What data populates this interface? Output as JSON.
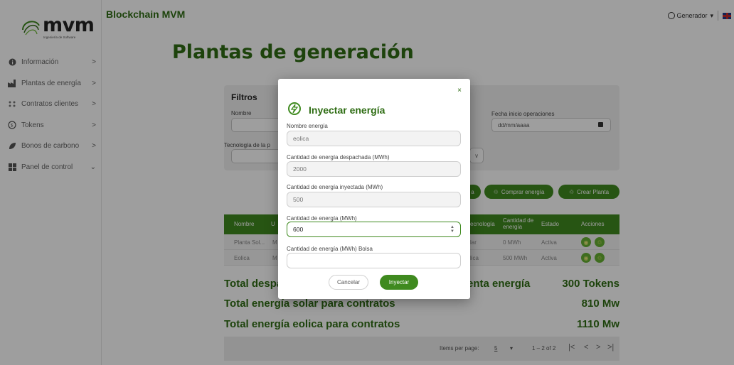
{
  "sidebar": {
    "logo_text": "mvm",
    "logo_sub": "Ingeniería de Software",
    "items": [
      {
        "label": "Información",
        "icon": "info-icon",
        "arrow": ">"
      },
      {
        "label": "Plantas de energía",
        "icon": "factory-icon",
        "arrow": ">"
      },
      {
        "label": "Contratos clientes",
        "icon": "contracts-icon",
        "arrow": ">"
      },
      {
        "label": "Tokens",
        "icon": "token-icon",
        "arrow": ">"
      },
      {
        "label": "Bonos de carbono",
        "icon": "leaf-icon",
        "arrow": ">"
      },
      {
        "label": "Panel de control",
        "icon": "dashboard-icon",
        "arrow": "⌄"
      }
    ]
  },
  "topbar": {
    "title": "Blockchain MVM",
    "user": "Generador",
    "user_caret": "▾"
  },
  "page": {
    "title": "Plantas de generación"
  },
  "filters": {
    "title": "Filtros",
    "nombre_label": "Nombre",
    "tecnologia_label": "Tecnología de la p",
    "fecha_label": "Fecha inicio operaciones",
    "fecha_placeholder": "dd/mm/aaaa"
  },
  "actions": {
    "first_partial": "a",
    "comprar": "Comprar energía",
    "crear": "Crear Planta"
  },
  "table": {
    "headers": {
      "nombre": "Nombre",
      "u": "U",
      "tecnologia": "ecnología",
      "cantidad": "Cantidad de energía",
      "estado": "Estado",
      "acciones": "Acciones"
    },
    "rows": [
      {
        "nombre": "Planta Sol...",
        "u": "M",
        "tecnologia": "lar",
        "cantidad": "0 MWh",
        "estado": "Activa"
      },
      {
        "nombre": "Eolica",
        "u": "M",
        "tecnologia": "lica",
        "cantidad": "500 MWh",
        "estado": "Activa"
      }
    ]
  },
  "summary": [
    {
      "label": "Total despa",
      "mid": "enta energía",
      "value": "300 Tokens"
    },
    {
      "label": "Total energía solar para contratos",
      "value": "810 Mw"
    },
    {
      "label": "Total energía eolica para contratos",
      "value": "1110 Mw"
    }
  ],
  "paginator": {
    "items_label": "Items per page:",
    "page_size": "5",
    "range": "1 – 2 of 2",
    "first": "|<",
    "prev": "<",
    "next": ">",
    "last": ">|"
  },
  "modal": {
    "title": "Inyectar energía",
    "close": "×",
    "fields": [
      {
        "label": "Nombre energía",
        "value": "eolica"
      },
      {
        "label": "Cantidad de energía despachada (MWh)",
        "value": "2000"
      },
      {
        "label": "Cantidad de energía inyectada (MWh)",
        "value": "500"
      },
      {
        "label": "Cantidad de energía (MWh)",
        "value": "600"
      },
      {
        "label": "Cantidad de energía (MWh) Bolsa",
        "value": ""
      }
    ],
    "cancel": "Cancelar",
    "submit": "Inyectar"
  },
  "colors": {
    "brand_green": "#3f8a1f",
    "title_green": "#2f6d14"
  }
}
